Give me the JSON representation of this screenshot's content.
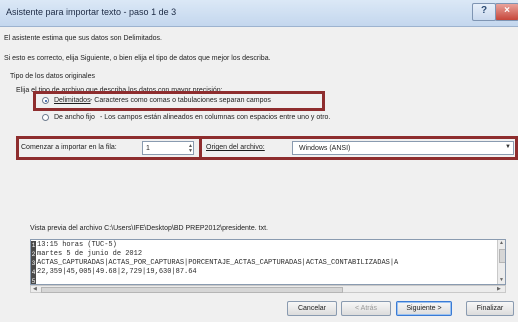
{
  "window": {
    "title": "Asistente para importar texto - paso 1 de 3",
    "help_glyph": "?",
    "close_glyph": "×"
  },
  "intro": {
    "line1": "El asistente estima que sus datos son Delimitados.",
    "line2": "Si esto es correcto, elija Siguiente, o bien elija el tipo de datos que mejor los describa."
  },
  "data_type": {
    "heading": "Tipo de los datos originales",
    "instruction": "Elija el tipo de archivo que describa los datos con mayor precisión:",
    "options": [
      {
        "label": "Delimitados",
        "desc": "- Caracteres como comas o tabulaciones separan campos",
        "selected": true
      },
      {
        "label": "De ancho fijo",
        "desc": "- Los campos están alineados en columnas con espacios entre uno y otro.",
        "selected": false
      }
    ]
  },
  "start_row": {
    "label": "Comenzar a importar en la fila:",
    "value": "1"
  },
  "origin": {
    "label": "Origen del archivo:",
    "value": "Windows (ANSI)"
  },
  "preview": {
    "label": "Vista previa del archivo C:\\Users\\IFE\\Desktop\\BD PREP2012\\presidente. txt.",
    "rows": [
      {
        "num": "1",
        "text": "13:15 horas (TUC-5)"
      },
      {
        "num": "2",
        "text": "martes 5 de junio de 2012"
      },
      {
        "num": "3",
        "text": "ACTAS_CAPTURADAS|ACTAS_POR_CAPTURAS|PORCENTAJE_ACTAS_CAPTURADAS|ACTAS_CONTABILIZADAS|A"
      },
      {
        "num": "4",
        "text": "22,359|45,005|49.68|2,729|19,630|87.64"
      },
      {
        "num": "5",
        "text": ""
      }
    ]
  },
  "buttons": {
    "cancel": "Cancelar",
    "back": "< Atrás",
    "next": "Siguiente >",
    "finish": "Finalizar"
  }
}
